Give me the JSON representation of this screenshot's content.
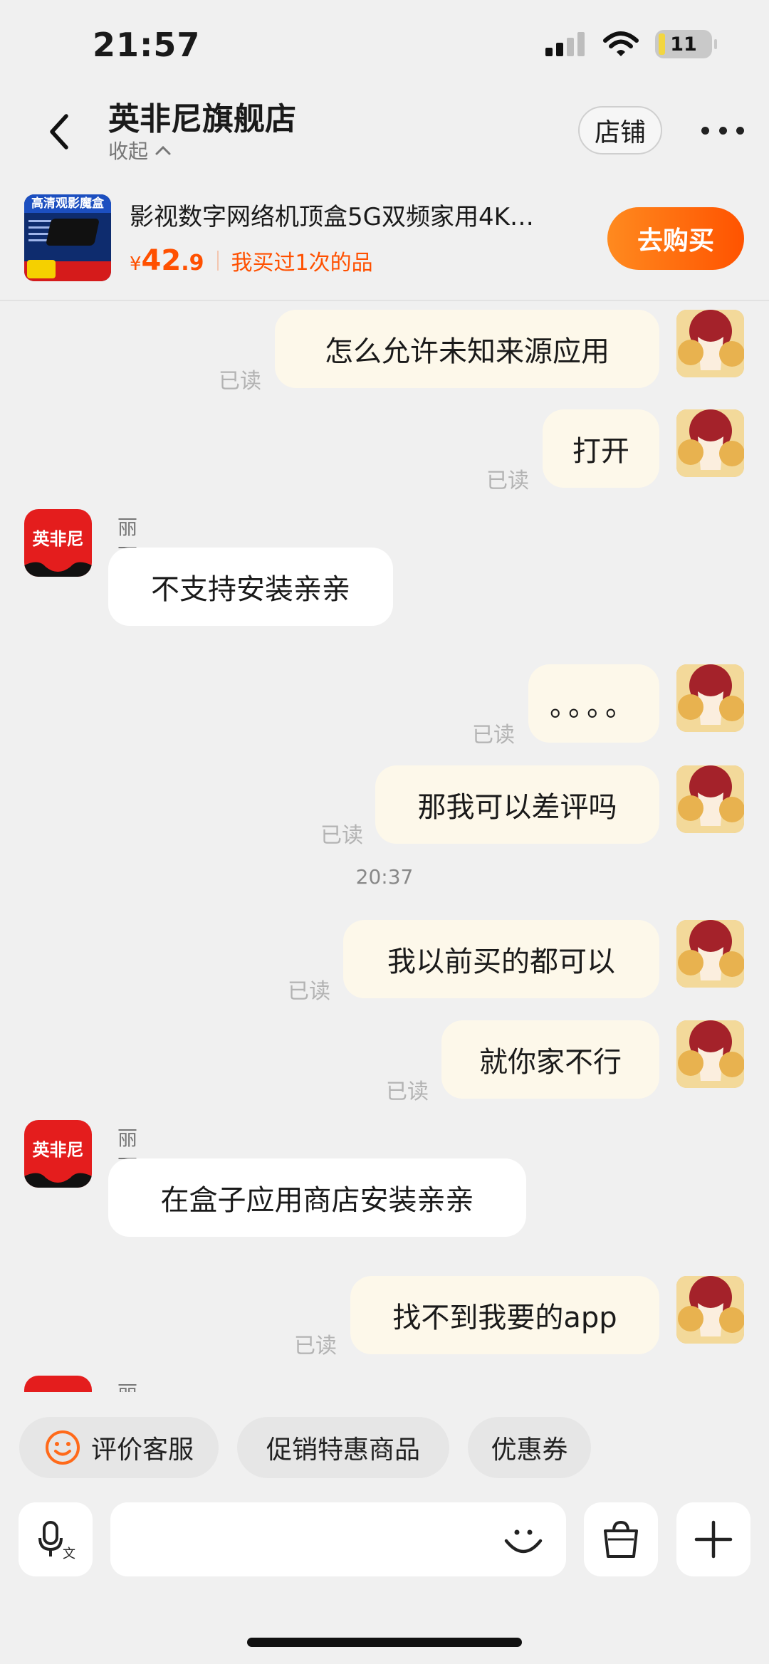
{
  "status_bar": {
    "time": "21:57",
    "battery": "11"
  },
  "header": {
    "store_name": "英非尼旗舰店",
    "collapse_label": "收起",
    "shop_button": "店铺"
  },
  "product": {
    "thumb_label": "高清观影魔盒",
    "name": "影视数字网络机顶盒5G双频家用4K…",
    "price_symbol": "¥",
    "price_int": "42",
    "price_dec": ".9",
    "bought_note": "我买过1次的品",
    "buy_button": "去购买"
  },
  "messages": [
    {
      "from": "me",
      "text": "怎么允许未知来源应用",
      "status": "已读"
    },
    {
      "from": "me",
      "text": "打开",
      "status": "已读"
    },
    {
      "from": "store",
      "sender": "丽丽",
      "avatar_text": "英非尼",
      "text": "不支持安装亲亲"
    },
    {
      "from": "me",
      "text": "。。。。",
      "status": "已读"
    },
    {
      "from": "me",
      "text": "那我可以差评吗",
      "status": "已读"
    },
    {
      "type": "time",
      "text": "20:37"
    },
    {
      "from": "me",
      "text": "我以前买的都可以",
      "status": "已读"
    },
    {
      "from": "me",
      "text": "就你家不行",
      "status": "已读"
    },
    {
      "from": "store",
      "sender": "丽丽",
      "avatar_text": "英非尼",
      "text": "在盒子应用商店安装亲亲"
    },
    {
      "from": "me",
      "text": "找不到我要的app",
      "status": "已读"
    },
    {
      "from": "store",
      "sender": "丽丽",
      "avatar_text": "",
      "text": ""
    }
  ],
  "quick_actions": [
    "评价客服",
    "促销特惠商品",
    "优惠券"
  ],
  "icons": {
    "back": "chevron-left-icon",
    "more": "more-dots-icon",
    "voice": "voice-to-text-icon",
    "emoji": "emoji-icon",
    "bag": "shopping-bag-icon",
    "plus": "plus-icon",
    "smile": "smile-face-icon"
  },
  "colors": {
    "accent": "#ff5000",
    "outgoing_bubble": "#fdf8ea",
    "incoming_bubble": "#ffffff",
    "background": "#f0f0f0"
  }
}
